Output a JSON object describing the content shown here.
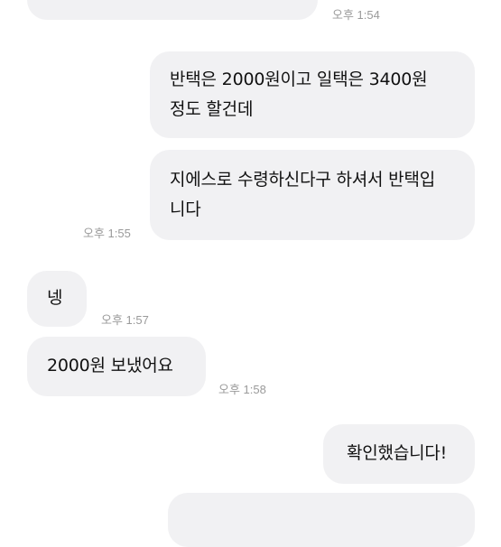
{
  "messages": [
    {
      "side": "received",
      "text": "",
      "time": "오후 1:54"
    },
    {
      "side": "sent",
      "lines": [
        "반택은 2000원이고 일택은 3400원",
        "정도 할건데"
      ],
      "time": ""
    },
    {
      "side": "sent",
      "lines": [
        "지에스로 수령하신다구 하셔서 반택입",
        "니다"
      ],
      "time": "오후 1:55"
    },
    {
      "side": "received",
      "text": "넹",
      "time": "오후 1:57"
    },
    {
      "side": "received",
      "text": "2000원 보냈어요",
      "time": "오후 1:58"
    },
    {
      "side": "sent",
      "text": "확인했습니다!",
      "time": ""
    },
    {
      "side": "sent",
      "text": "",
      "time": ""
    }
  ]
}
